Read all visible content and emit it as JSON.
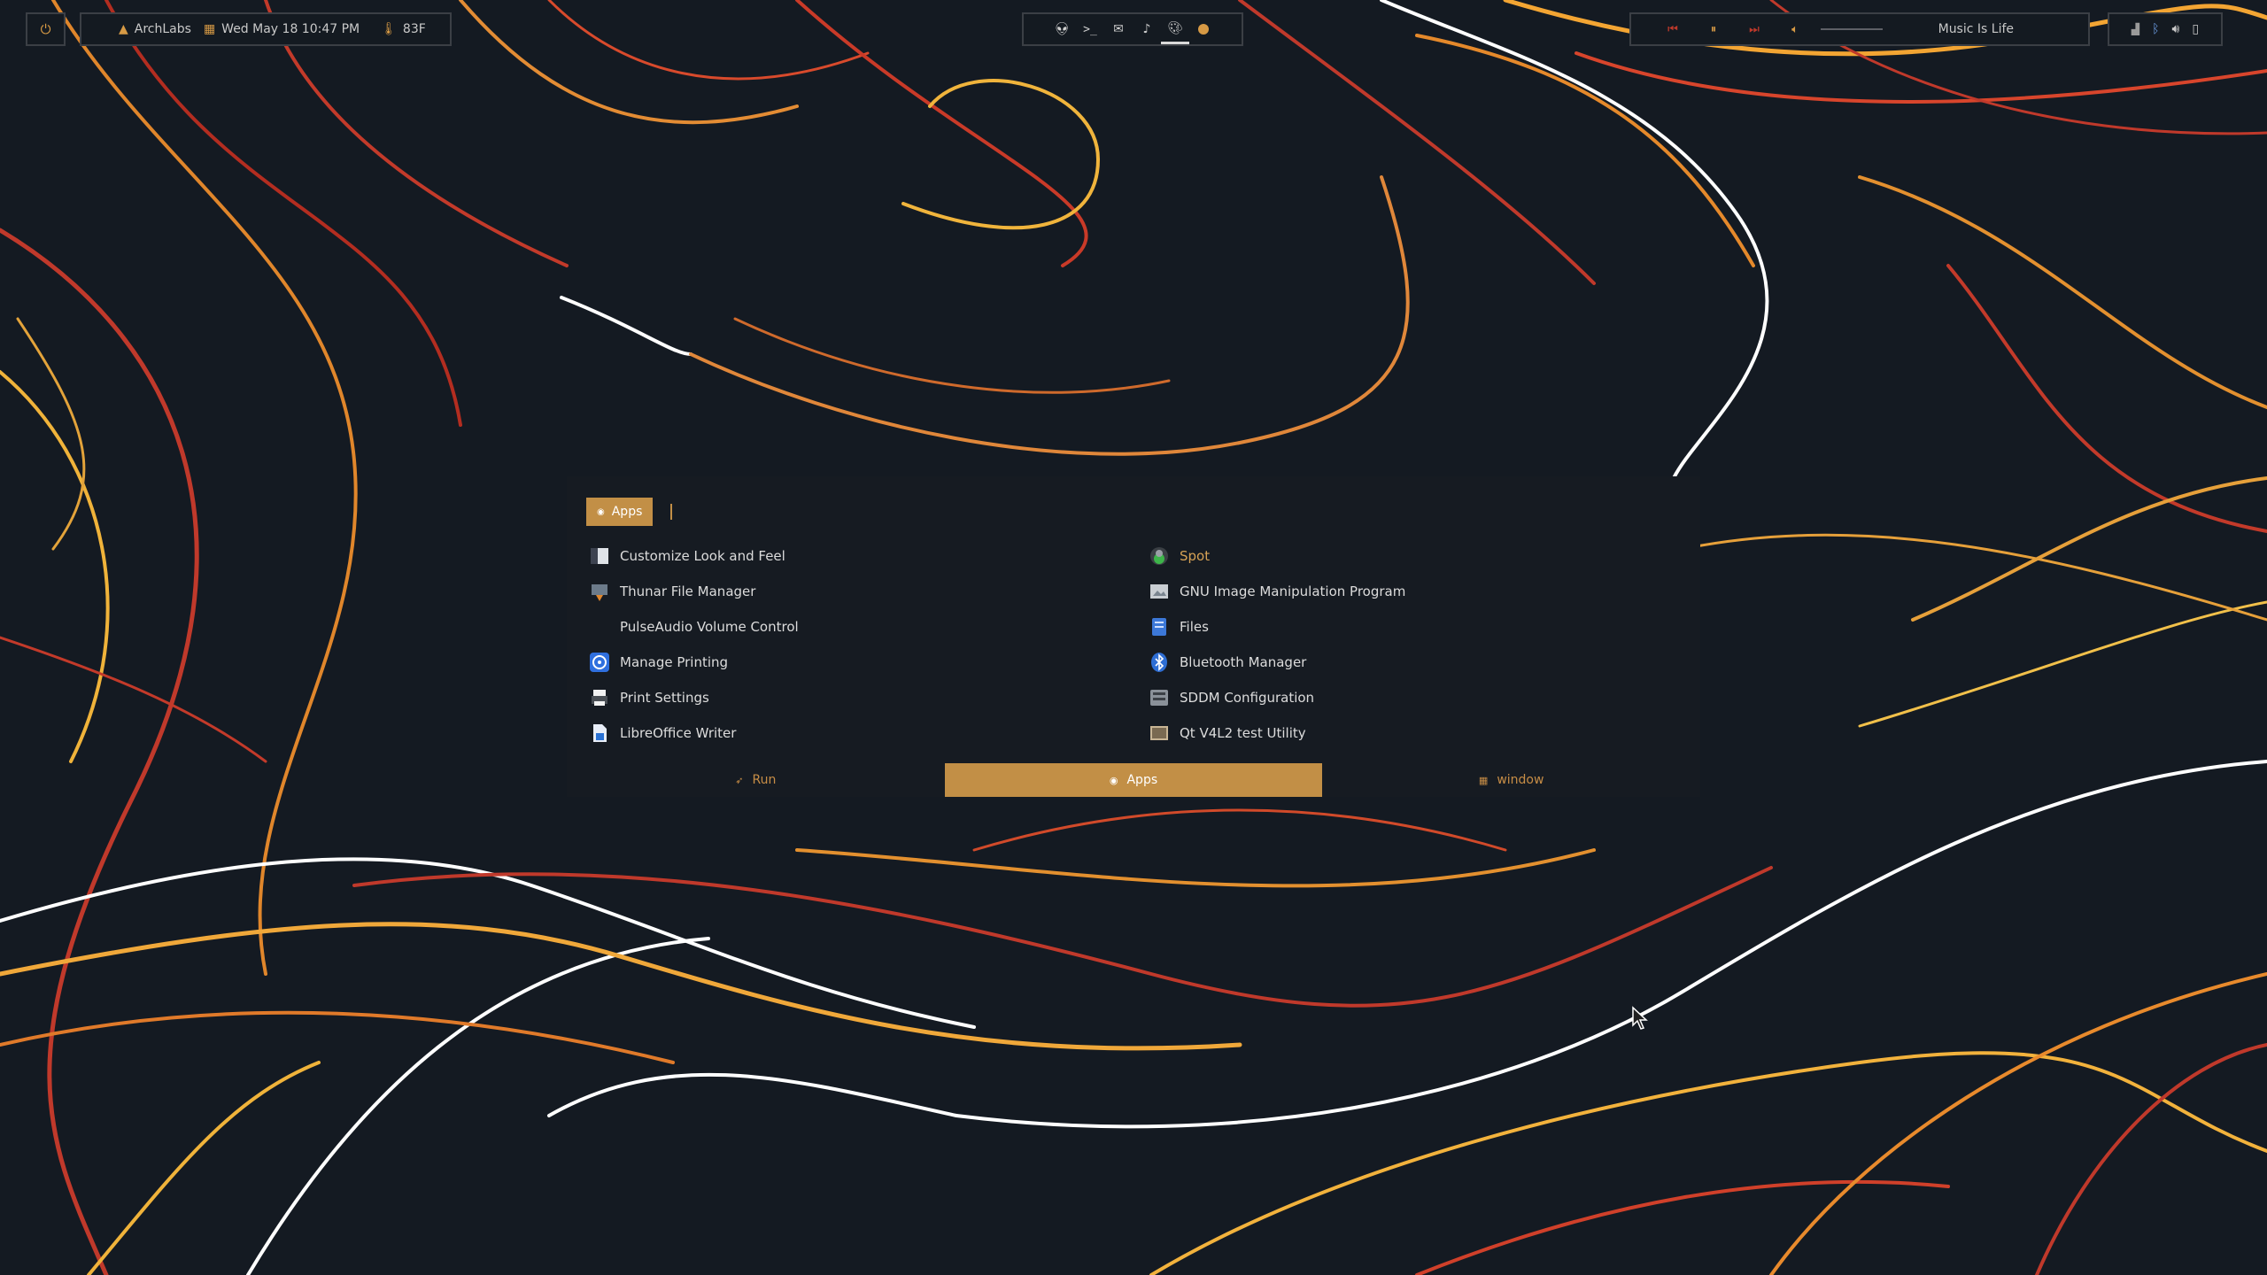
{
  "topbar": {
    "power_icon": "power-icon",
    "distro": "ArchLabs",
    "datetime": "Wed May 18 10:47 PM",
    "temperature": "83F"
  },
  "workspaces": {
    "icons": [
      "alien-icon",
      "terminal-icon",
      "mail-icon",
      "music-note-icon",
      "palette-icon",
      "dot-icon"
    ],
    "active_index": 4
  },
  "music": {
    "prev_icon": "previous-icon",
    "pause_icon": "pause-icon",
    "next_icon": "next-icon",
    "volume_icon": "volume-icon",
    "song": "Music Is Life"
  },
  "tray": {
    "icons": [
      "signal-icon",
      "bluetooth-icon",
      "speaker-icon",
      "battery-icon"
    ]
  },
  "launcher": {
    "mode_label": "Apps",
    "query": "",
    "entries": [
      {
        "label": "Customize Look and Feel",
        "icon": "appearance-icon"
      },
      {
        "label": "Spot",
        "icon": "spot-icon",
        "selected": true
      },
      {
        "label": "Thunar File Manager",
        "icon": "thunar-icon"
      },
      {
        "label": "GNU Image Manipulation Program",
        "icon": "gimp-icon"
      },
      {
        "label": "PulseAudio Volume Control",
        "icon": "pulseaudio-icon"
      },
      {
        "label": "Files",
        "icon": "files-icon"
      },
      {
        "label": "Manage Printing",
        "icon": "printing-icon"
      },
      {
        "label": "Bluetooth Manager",
        "icon": "bluetooth-manager-icon"
      },
      {
        "label": "Print Settings",
        "icon": "printer-icon"
      },
      {
        "label": "SDDM Configuration",
        "icon": "sddm-icon"
      },
      {
        "label": "LibreOffice Writer",
        "icon": "writer-icon"
      },
      {
        "label": "Qt V4L2 test Utility",
        "icon": "qv4l2-icon"
      }
    ],
    "modes": [
      {
        "label": "Run",
        "icon": "rocket-icon"
      },
      {
        "label": "Apps",
        "icon": "apps-icon",
        "active": true
      },
      {
        "label": "window",
        "icon": "grid-icon"
      }
    ]
  }
}
